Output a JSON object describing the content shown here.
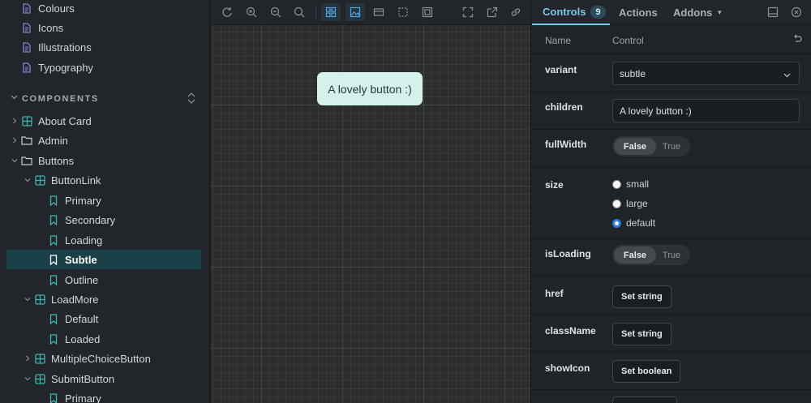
{
  "sidebar": {
    "top_items": [
      {
        "label": "Colours",
        "icon": "document-icon"
      },
      {
        "label": "Icons",
        "icon": "document-icon"
      },
      {
        "label": "Illustrations",
        "icon": "document-icon"
      },
      {
        "label": "Typography",
        "icon": "document-icon"
      }
    ],
    "section": {
      "label": "COMPONENTS"
    },
    "tree": [
      {
        "label": "About Card",
        "icon": "component-icon"
      },
      {
        "label": "Admin",
        "icon": "folder-icon"
      },
      {
        "label": "Buttons",
        "icon": "folder-icon"
      },
      {
        "label": "ButtonLink",
        "icon": "component-icon"
      },
      {
        "label": "Primary",
        "icon": "bookmark-icon"
      },
      {
        "label": "Secondary",
        "icon": "bookmark-icon"
      },
      {
        "label": "Loading",
        "icon": "bookmark-icon"
      },
      {
        "label": "Subtle",
        "icon": "bookmark-icon",
        "selected": true
      },
      {
        "label": "Outline",
        "icon": "bookmark-icon"
      },
      {
        "label": "LoadMore",
        "icon": "component-icon"
      },
      {
        "label": "Default",
        "icon": "bookmark-icon"
      },
      {
        "label": "Loaded",
        "icon": "bookmark-icon"
      },
      {
        "label": "MultipleChoiceButton",
        "icon": "component-icon"
      },
      {
        "label": "SubmitButton",
        "icon": "component-icon"
      },
      {
        "label": "Primary",
        "icon": "bookmark-icon"
      }
    ]
  },
  "preview": {
    "button_label": "A lovely button :)"
  },
  "panel": {
    "tabs": {
      "controls": "Controls",
      "controls_count": "9",
      "actions": "Actions",
      "addons": "Addons"
    },
    "header": {
      "name": "Name",
      "control": "Control"
    },
    "props": {
      "variant": {
        "name": "variant",
        "value": "subtle"
      },
      "children": {
        "name": "children",
        "value": "A lovely button :)"
      },
      "fullWidth": {
        "name": "fullWidth",
        "false_label": "False",
        "true_label": "True"
      },
      "size": {
        "name": "size",
        "options": [
          "small",
          "large",
          "default"
        ],
        "selected": "default"
      },
      "isLoading": {
        "name": "isLoading",
        "false_label": "False",
        "true_label": "True"
      },
      "href": {
        "name": "href",
        "button": "Set string"
      },
      "className": {
        "name": "className",
        "button": "Set string"
      },
      "showIcon": {
        "name": "showIcon",
        "button": "Set boolean"
      }
    }
  },
  "colors": {
    "accent": "#79c8ea",
    "selected_bg": "#1b4148",
    "preview_button_bg": "#d4f1ec",
    "radio_checked": "#2a7be4"
  }
}
